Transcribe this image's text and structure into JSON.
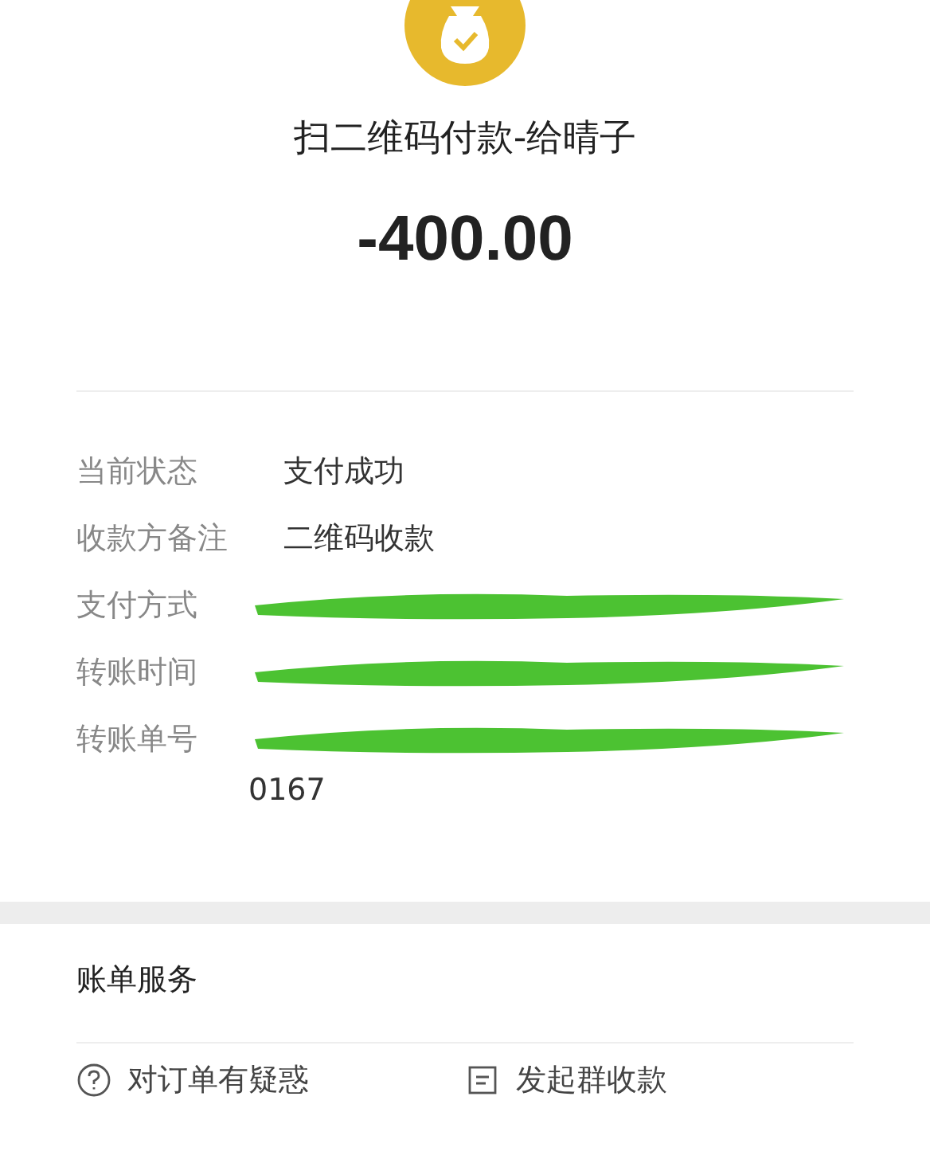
{
  "header": {
    "title": "扫二维码付款-给晴子",
    "amount": "-400.00"
  },
  "details": [
    {
      "label": "当前状态",
      "value": "支付成功",
      "redacted": false
    },
    {
      "label": "收款方备注",
      "value": "二维码收款",
      "redacted": false
    },
    {
      "label": "支付方式",
      "redacted": true
    },
    {
      "label": "转账时间",
      "redacted": true
    },
    {
      "label": "转账单号",
      "value": "0167",
      "redacted": true
    }
  ],
  "services": {
    "title": "账单服务",
    "items": [
      {
        "label": "对订单有疑惑",
        "kind": "help"
      },
      {
        "label": "发起群收款",
        "kind": "group"
      }
    ]
  }
}
